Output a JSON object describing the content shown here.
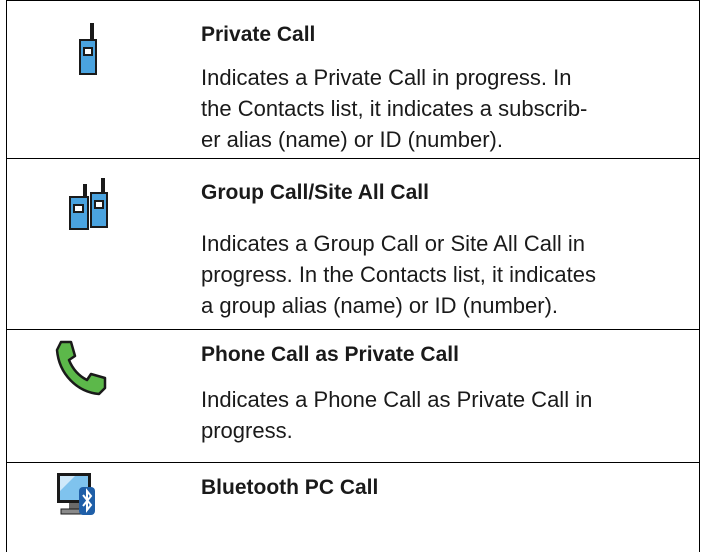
{
  "rows": [
    {
      "icon": "private-call-radio-icon",
      "title": "Private Call",
      "desc_lines": [
        "Indicates a Private Call in progress. In",
        "the Contacts list, it indicates a subscrib-",
        "er alias (name) or ID (number)."
      ]
    },
    {
      "icon": "group-call-radios-icon",
      "title": "Group Call/Site All Call",
      "desc_lines": [
        "Indicates a Group Call or Site All Call in",
        "progress. In the Contacts list, it indicates",
        "a group alias (name) or ID (number)."
      ]
    },
    {
      "icon": "phone-handset-icon",
      "title": "Phone Call as Private Call",
      "desc_lines": [
        "Indicates a Phone Call as Private Call in",
        "progress."
      ]
    },
    {
      "icon": "bluetooth-pc-icon",
      "title": "Bluetooth PC Call",
      "desc_lines": []
    }
  ],
  "colors": {
    "radio_blue": "#4aa3df",
    "phone_green": "#5cb84a",
    "border": "#000000"
  }
}
